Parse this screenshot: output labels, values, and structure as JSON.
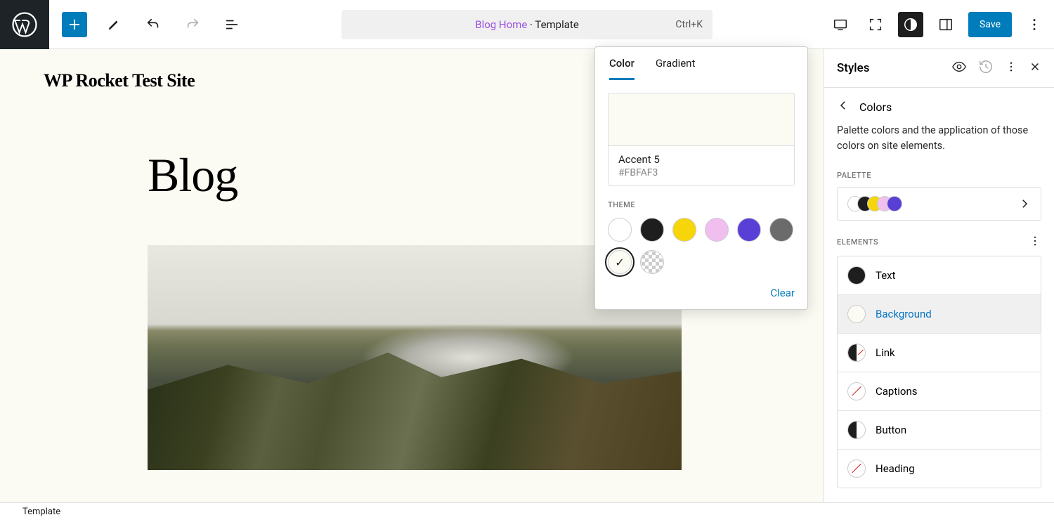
{
  "topbar": {
    "page_label": "Blog Home",
    "page_suffix": " · Template",
    "shortcut": "Ctrl+K",
    "save_label": "Save"
  },
  "canvas": {
    "site_title": "WP Rocket Test Site",
    "heading": "Blog"
  },
  "color_popover": {
    "tabs": {
      "color": "Color",
      "gradient": "Gradient"
    },
    "selected_name": "Accent 5",
    "selected_hex": "#FBFAF3",
    "theme_label": "THEME",
    "theme_colors": [
      "#ffffff",
      "#1e1e1e",
      "#f6d60a",
      "#f0bff0",
      "#5a3fd6",
      "#6b6b6b"
    ],
    "selected_extra": "#fbfaf3",
    "clear_label": "Clear"
  },
  "styles": {
    "title": "Styles",
    "section": "Colors",
    "description": "Palette colors and the application of those colors on site elements.",
    "palette_label": "PALETTE",
    "palette_colors": [
      "#ffffff",
      "#1e1e1e",
      "#f6d60a",
      "#f0bff0",
      "#5a3fd6"
    ],
    "elements_label": "ELEMENTS",
    "elements": [
      {
        "label": "Text",
        "swatch": "#1e1e1e",
        "type": "solid"
      },
      {
        "label": "Background",
        "swatch": "#fbfaf3",
        "type": "solid",
        "active": true
      },
      {
        "label": "Link",
        "type": "halfdiag"
      },
      {
        "label": "Captions",
        "type": "diag"
      },
      {
        "label": "Button",
        "type": "half"
      },
      {
        "label": "Heading",
        "type": "diag"
      }
    ]
  },
  "footer": {
    "label": "Template"
  }
}
